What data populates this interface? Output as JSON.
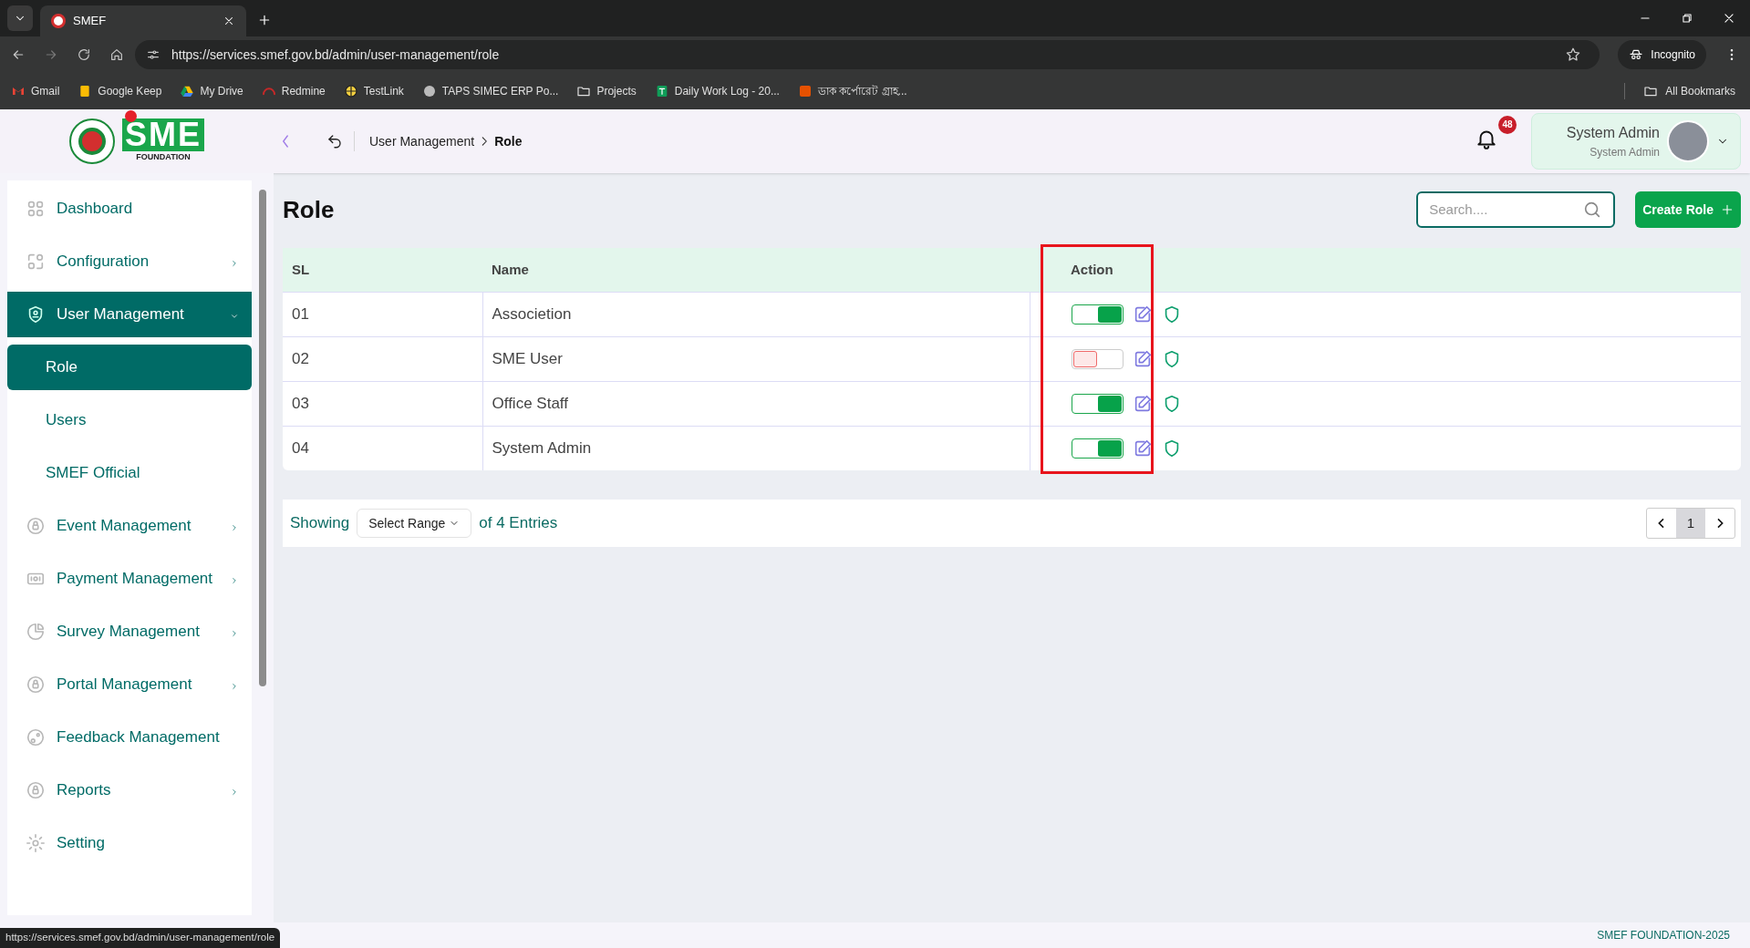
{
  "browser": {
    "tabs": [
      {
        "title": "SMEF",
        "selected": true
      }
    ],
    "url": "https://services.smef.gov.bd/admin/user-management/role",
    "incognito_label": "Incognito",
    "bookmarks": [
      "Gmail",
      "Google Keep",
      "My Drive",
      "Redmine",
      "TestLink",
      "TAPS SIMEC ERP Po...",
      "Projects",
      "Daily Work Log - 20...",
      "ডাক কর্পোরেট গ্রাহ..."
    ],
    "all_bookmarks": "All Bookmarks",
    "status_url": "https://services.smef.gov.bd/admin/user-management/role"
  },
  "logo": {
    "wordmark": "SME",
    "subtitle": "FOUNDATION"
  },
  "header": {
    "breadcrumb": [
      "User Management",
      "Role"
    ],
    "notification_count": "48",
    "user_name": "System Admin",
    "user_role": "System Admin"
  },
  "sidebar": {
    "items": [
      {
        "label": "Dashboard",
        "expandable": false,
        "selected": false
      },
      {
        "label": "Configuration",
        "expandable": true,
        "expanded": false,
        "selected": false
      },
      {
        "label": "User Management",
        "expandable": true,
        "expanded": true,
        "selected": true,
        "children": [
          {
            "label": "Role",
            "selected": true
          },
          {
            "label": "Users",
            "selected": false
          },
          {
            "label": "SMEF Official",
            "selected": false
          }
        ]
      },
      {
        "label": "Event Management",
        "expandable": true,
        "expanded": false,
        "selected": false
      },
      {
        "label": "Payment Management",
        "expandable": true,
        "expanded": false,
        "selected": false
      },
      {
        "label": "Survey Management",
        "expandable": true,
        "expanded": false,
        "selected": false
      },
      {
        "label": "Portal Management",
        "expandable": true,
        "expanded": false,
        "selected": false
      },
      {
        "label": "Feedback Management",
        "expandable": false,
        "selected": false
      },
      {
        "label": "Reports",
        "expandable": true,
        "expanded": false,
        "selected": false
      },
      {
        "label": "Setting",
        "expandable": false,
        "selected": false
      }
    ]
  },
  "page": {
    "title": "Role",
    "search": {
      "placeholder": "Search...."
    },
    "create_button": "Create Role"
  },
  "table": {
    "columns": [
      "SL",
      "Name",
      "Action"
    ],
    "rows": [
      {
        "sl": "01",
        "name": "Associetion",
        "active": true
      },
      {
        "sl": "02",
        "name": "SME User",
        "active": false
      },
      {
        "sl": "03",
        "name": "Office Staff",
        "active": true
      },
      {
        "sl": "04",
        "name": "System Admin",
        "active": true
      }
    ]
  },
  "pagination": {
    "showing": "Showing",
    "range": "Select Range",
    "entries": "of 4 Entries",
    "pages": [
      {
        "label": "1",
        "selected": true
      }
    ]
  },
  "footer": "SMEF FOUNDATION-2025"
}
